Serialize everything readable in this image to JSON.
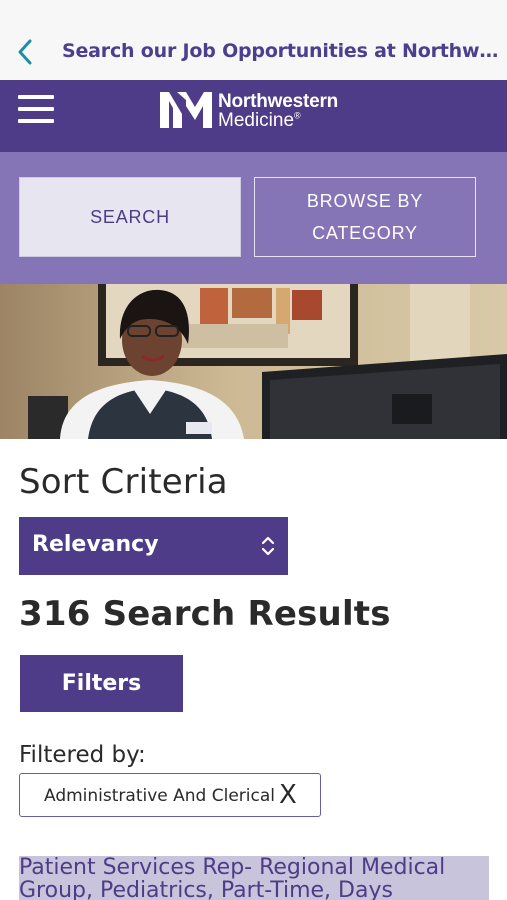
{
  "nav": {
    "title": "Search our Job Opportunities at Northwestern Medicine",
    "back_icon": "chevron-left-icon"
  },
  "brand": {
    "menu_icon": "hamburger-menu-icon",
    "logo_line1": "Northwestern",
    "logo_line2": "Medicine",
    "logo_reg": "®",
    "color": "#4e3c88"
  },
  "tabs": {
    "search": "SEARCH",
    "browse_line1": "BROWSE BY",
    "browse_line2": "CATEGORY"
  },
  "hero": {
    "image": "receptionist-photo"
  },
  "sort": {
    "title": "Sort Criteria",
    "selected": "Relevancy",
    "icon": "up-down-chevron-icon"
  },
  "results": {
    "count_text": "316 Search Results"
  },
  "filters": {
    "button_label": "Filters",
    "filtered_by_label": "Filtered by:",
    "active_chip": "Administrative And Clerical",
    "remove_label": "X"
  },
  "jobs": [
    {
      "title": "Patient Services Rep- Regional Medical Group, Pediatrics, Part-Time, Days"
    }
  ],
  "colors": {
    "accent": "#4e3c88",
    "tab_band": "#8575b6",
    "link_bg": "#c8c4dc"
  }
}
